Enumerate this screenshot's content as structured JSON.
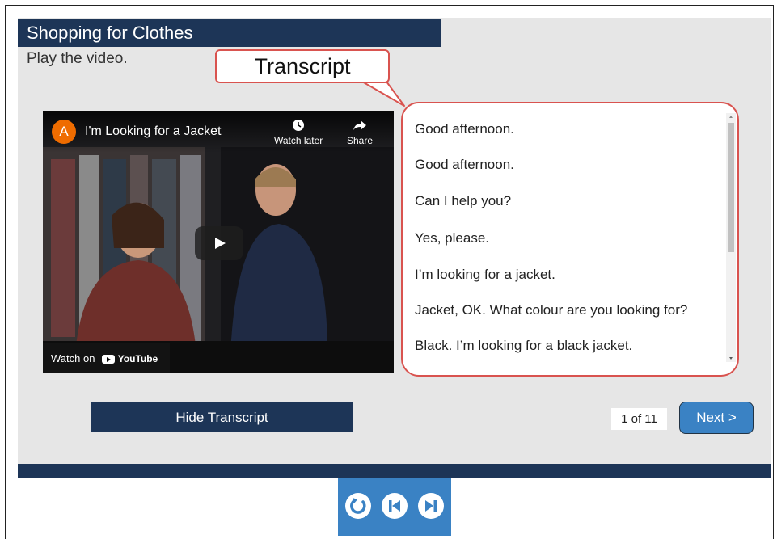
{
  "header": {
    "title": "Shopping for Clothes"
  },
  "instruction": "Play the video.",
  "callout": {
    "label": "Transcript"
  },
  "video": {
    "avatar_letter": "A",
    "title": "I'm Looking for a Jacket",
    "watch_later": "Watch later",
    "share": "Share",
    "watch_on": "Watch on",
    "youtube": "YouTube"
  },
  "transcript": {
    "lines": [
      "Good afternoon.",
      "Good afternoon.",
      "Can I help you?",
      "Yes, please.",
      "I’m looking for a jacket.",
      "Jacket, OK. What colour are you looking for?",
      "Black. I’m looking for a black jacket."
    ]
  },
  "controls": {
    "hide_transcript": "Hide Transcript",
    "counter": "1 of 11",
    "next": "Next >"
  },
  "nav": {
    "icons": [
      "restart-icon",
      "previous-icon",
      "next-icon"
    ]
  },
  "colors": {
    "navy": "#1d3557",
    "accent_blue": "#3a82c4",
    "callout_red": "#d9534f"
  }
}
